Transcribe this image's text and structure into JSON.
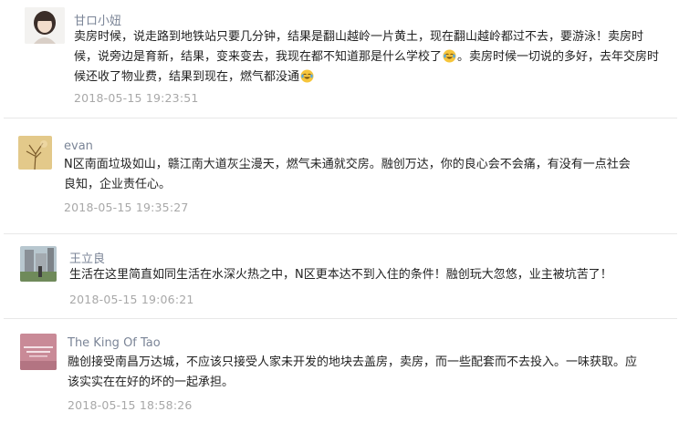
{
  "comments": [
    {
      "username": "甘ロ小妞",
      "text_parts": [
        "卖房时候，说走路到地铁站只要几分钟，结果是翻山越岭一片黄土，现在翻山越岭都过不去，要游泳！卖房时候，说旁边是育新，结果，变来变去，我现在都不知道那是什么学校了",
        "。卖房时候一切说的多好，去年交房时候还收了物业费，结果到现在，燃气都没通"
      ],
      "time": "2018-05-15 19:23:51",
      "avatar_icon": "girl-portrait-avatar"
    },
    {
      "username": "evan",
      "text": "N区南面垃圾如山，赣江南大道灰尘漫天，燃气未通就交房。融创万达，你的良心会不会痛，有没有一点社会良知，企业责任心。",
      "time": "2018-05-15 19:35:27",
      "avatar_icon": "bare-tree-avatar"
    },
    {
      "username": "王立良",
      "text": "生活在这里简直如同生活在水深火热之中，N区更本达不到入住的条件！融创玩大忽悠，业主被坑苦了！",
      "time": "2018-05-15 19:06:21",
      "avatar_icon": "city-building-avatar"
    },
    {
      "username": "The King Of Tao",
      "text": "融创接受南昌万达城，不应该只接受人家未开发的地块去盖房，卖房，而一些配套而不去投入。一味获取。应该实实在在好的坏的一起承担。",
      "time": "2018-05-15 18:58:26",
      "avatar_icon": "pink-text-avatar"
    }
  ],
  "colors": {
    "username": "#7b8597",
    "text": "#222222",
    "time": "#a8a8a8",
    "divider": "#e8e8e8"
  }
}
